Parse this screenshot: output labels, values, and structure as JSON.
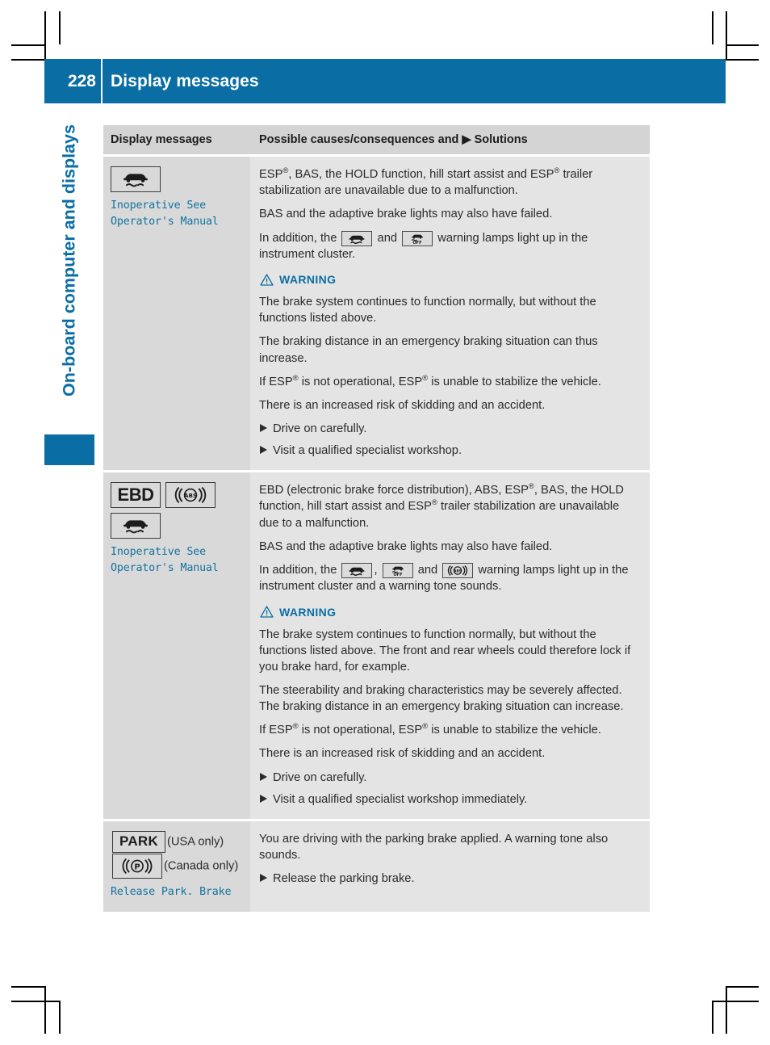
{
  "colors": {
    "brand_blue": "#0a6ea4",
    "message_blue": "#12749f",
    "table_bg_left": "#d9d9d9",
    "table_bg_right": "#e4e4e4",
    "table_header_bg": "#d4d4d4"
  },
  "header": {
    "page_number": "228",
    "title": "Display messages"
  },
  "chapter": {
    "title": "On-board computer and displays"
  },
  "table": {
    "columns": {
      "left": "Display messages",
      "right": "Possible causes/consequences and ▶ Solutions"
    },
    "rows": [
      {
        "id": "esp-inoperative",
        "icons": [
          "esp-skid-icon"
        ],
        "message": "Inoperative See\nOperator's Manual",
        "paragraphs": [
          "ESP®, BAS, the HOLD function, hill start assist and ESP® trailer stabilization are unavailable due to a malfunction.",
          "BAS and the adaptive brake lights may also have failed.",
          "In addition, the [esp-skid-icon] and [esp-off-icon] warning lamps light up in the instrument cluster."
        ],
        "warning": {
          "label": "WARNING",
          "paragraphs": [
            "The brake system continues to function normally, but without the functions listed above.",
            "The braking distance in an emergency braking situation can thus increase.",
            "If ESP® is not operational, ESP® is unable to stabilize the vehicle.",
            "There is an increased risk of skidding and an accident."
          ],
          "actions": [
            "Drive on carefully.",
            "Visit a qualified specialist workshop."
          ]
        }
      },
      {
        "id": "ebd-inoperative",
        "icons": [
          "ebd-icon",
          "abs-icon",
          "esp-skid-icon"
        ],
        "ebd_label": "EBD",
        "message": "Inoperative See\nOperator's Manual",
        "paragraphs": [
          "EBD (electronic brake force distribution), ABS, ESP®, BAS, the HOLD function, hill start assist and ESP® trailer stabilization are unavailable due to a malfunction.",
          "BAS and the adaptive brake lights may also have failed.",
          "In addition, the [esp-skid-icon], [esp-off-icon] and [abs-icon] warning lamps light up in the instrument cluster and a warning tone sounds."
        ],
        "warning": {
          "label": "WARNING",
          "paragraphs": [
            "The brake system continues to function normally, but without the functions listed above. The front and rear wheels could therefore lock if you brake hard, for example.",
            "The steerability and braking characteristics may be severely affected. The braking distance in an emergency braking situation can increase.",
            "If ESP® is not operational, ESP® is unable to stabilize the vehicle.",
            "There is an increased risk of skidding and an accident."
          ],
          "actions": [
            "Drive on carefully.",
            "Visit a qualified specialist workshop immediately."
          ]
        }
      },
      {
        "id": "release-parking-brake",
        "park_label": "PARK",
        "usa_note": "(USA only)",
        "canada_note": "(Canada only)",
        "message": "Release Park. Brake",
        "paragraphs": [
          "You are driving with the parking brake applied. A warning tone also sounds."
        ],
        "actions": [
          "Release the parking brake."
        ]
      }
    ]
  }
}
